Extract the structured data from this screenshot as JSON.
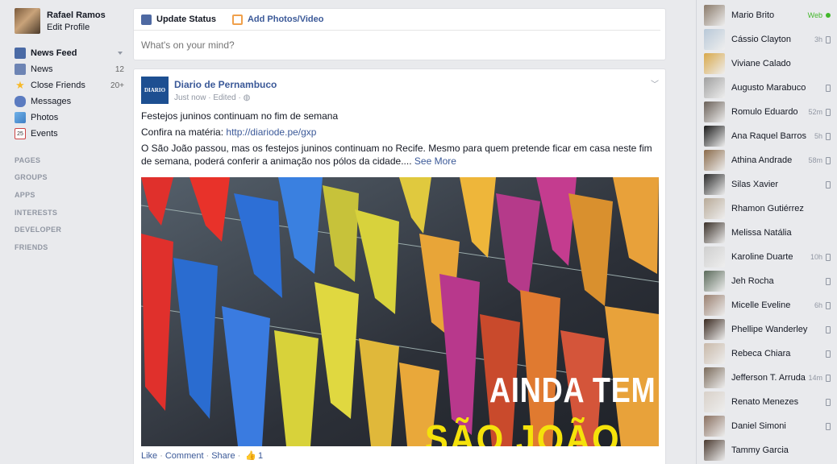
{
  "profile": {
    "name": "Rafael Ramos",
    "edit_label": "Edit Profile"
  },
  "nav": [
    {
      "label": "News Feed",
      "count": "",
      "icon": "news-feed-icon",
      "selected": true
    },
    {
      "label": "News",
      "count": "12",
      "icon": "rss-icon"
    },
    {
      "label": "Close Friends",
      "count": "20+",
      "icon": "star-icon"
    },
    {
      "label": "Messages",
      "count": "",
      "icon": "messages-icon"
    },
    {
      "label": "Photos",
      "count": "",
      "icon": "photos-icon"
    },
    {
      "label": "Events",
      "count": "",
      "icon": "calendar-icon",
      "icon_text": "25"
    }
  ],
  "sections": [
    "PAGES",
    "GROUPS",
    "APPS",
    "INTERESTS",
    "DEVELOPER",
    "FRIENDS"
  ],
  "composer": {
    "tab_status": "Update Status",
    "tab_photos": "Add Photos/Video",
    "placeholder": "What's on your mind?"
  },
  "post": {
    "page_logo_text": "DIARIO",
    "page_name": "Diario de Pernambuco",
    "meta": "Just now · Edited · ",
    "line1": "Festejos juninos continuam no fim de semana",
    "line2_prefix": "Confira na matéria: ",
    "line2_link": "http://diariode.pe/gxp",
    "line3": "O São João passou, mas os festejos juninos continuam no Recife. Mesmo para quem pretende ficar em casa neste fim de semana, poderá conferir a animação nos pólos da cidade.... ",
    "see_more": "See More",
    "image_text1": "AINDA TEM",
    "image_text2": "SÃO JOÃO",
    "actions": {
      "like": "Like",
      "comment": "Comment",
      "share": "Share",
      "like_count": "1"
    }
  },
  "friends": [
    {
      "name": "Mario Brito",
      "status": "Web",
      "type": "web"
    },
    {
      "name": "Cássio Clayton",
      "status": "3h",
      "type": "mobile"
    },
    {
      "name": "Viviane Calado",
      "status": "",
      "type": "none"
    },
    {
      "name": "Augusto Marabuco",
      "status": "",
      "type": "mobile"
    },
    {
      "name": "Romulo Eduardo",
      "status": "52m",
      "type": "mobile"
    },
    {
      "name": "Ana Raquel Barros",
      "status": "5h",
      "type": "mobile"
    },
    {
      "name": "Athina Andrade",
      "status": "58m",
      "type": "mobile"
    },
    {
      "name": "Silas Xavier",
      "status": "",
      "type": "mobile"
    },
    {
      "name": "Rhamon Gutiérrez",
      "status": "",
      "type": "none"
    },
    {
      "name": "Melissa Natália",
      "status": "",
      "type": "none"
    },
    {
      "name": "Karoline Duarte",
      "status": "10h",
      "type": "mobile"
    },
    {
      "name": "Jeh Rocha",
      "status": "",
      "type": "mobile"
    },
    {
      "name": "Micelle Eveline",
      "status": "6h",
      "type": "mobile"
    },
    {
      "name": "Phellipe Wanderley",
      "status": "",
      "type": "mobile"
    },
    {
      "name": "Rebeca Chiara",
      "status": "",
      "type": "mobile"
    },
    {
      "name": "Jefferson T. Arruda",
      "status": "14m",
      "type": "mobile"
    },
    {
      "name": "Renato Menezes",
      "status": "",
      "type": "mobile"
    },
    {
      "name": "Daniel Simoni",
      "status": "",
      "type": "mobile"
    },
    {
      "name": "Tammy Garcia",
      "status": "",
      "type": "none"
    }
  ],
  "colors": {
    "brand": "#3b5998",
    "online": "#42b72a",
    "bg": "#e9eaed"
  }
}
